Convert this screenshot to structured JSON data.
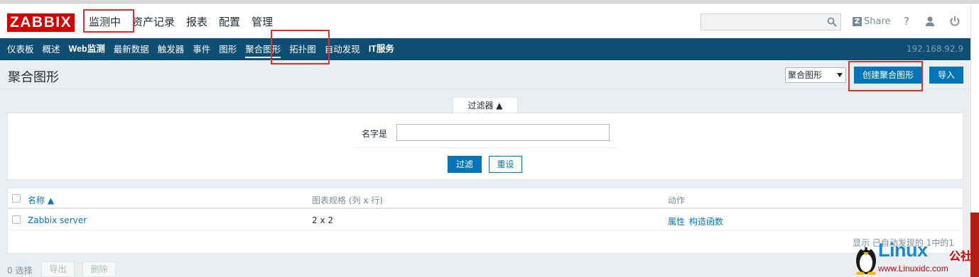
{
  "header": {
    "logo": "ZABBIX",
    "nav": [
      "监测中",
      "资产记录",
      "报表",
      "配置",
      "管理"
    ],
    "share_label": "Share",
    "search_value": ""
  },
  "subnav": {
    "items": [
      "仪表板",
      "概述",
      "Web监测",
      "最新数据",
      "触发器",
      "事件",
      "图形",
      "聚合图形",
      "拓扑图",
      "自动发现",
      "IT服务"
    ],
    "active_index": 7,
    "ip": "192.168.92.9"
  },
  "page": {
    "title": "聚合图形",
    "type_select": "聚合图形",
    "create_button": "创建聚合图形",
    "import_button": "导入"
  },
  "filter": {
    "tab_label": "过滤器 ▲",
    "name_label": "名字是",
    "name_value": "",
    "apply_button": "过滤",
    "reset_button": "重设"
  },
  "table": {
    "columns": [
      "名称 ▲",
      "图表规格 (列 x 行)",
      "动作"
    ],
    "rows": [
      {
        "name": "Zabbix server",
        "dimensions": "2 x 2",
        "actions": [
          "属性",
          "构造函数"
        ]
      }
    ],
    "footer": "显示 已自动发现的 1中的1"
  },
  "bottom": {
    "selected": "0 选择",
    "export_button": "导出",
    "delete_button": "删除"
  },
  "watermark": {
    "brand": "Linux",
    "suffix": "公社",
    "url": "www.Linuxidc.com"
  },
  "colors": {
    "logo_red": "#d40000",
    "subnav_blue": "#0e4e73",
    "button_blue": "#0275b8",
    "highlight_red": "#e0302e"
  }
}
